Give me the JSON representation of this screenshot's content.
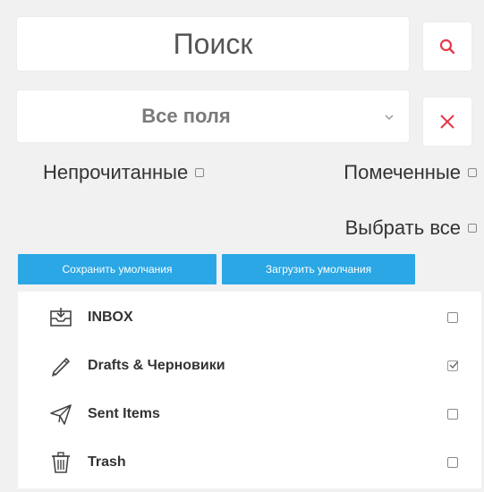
{
  "search": {
    "placeholder": "Поиск",
    "icon": "search-icon",
    "accent": "#e5394a"
  },
  "field_select": {
    "value": "Все поля",
    "icon": "chevron-down-icon"
  },
  "clear": {
    "icon": "close-icon",
    "color": "#e5394a"
  },
  "filters": {
    "unread_label": "Непрочитанные",
    "unread_checked": false,
    "flagged_label": "Помеченные",
    "flagged_checked": false,
    "select_all_label": "Выбрать все",
    "select_all_checked": false
  },
  "buttons": {
    "save_defaults": "Сохранить умолчания",
    "load_defaults": "Загрузить умолчания",
    "color": "#2aa7e4"
  },
  "folders": [
    {
      "label": "INBOX",
      "icon": "inbox-icon",
      "checked": false
    },
    {
      "label": "Drafts & Черновики",
      "icon": "pencil-icon",
      "checked": true
    },
    {
      "label": "Sent Items",
      "icon": "send-icon",
      "checked": false
    },
    {
      "label": "Trash",
      "icon": "trash-icon",
      "checked": false
    }
  ]
}
